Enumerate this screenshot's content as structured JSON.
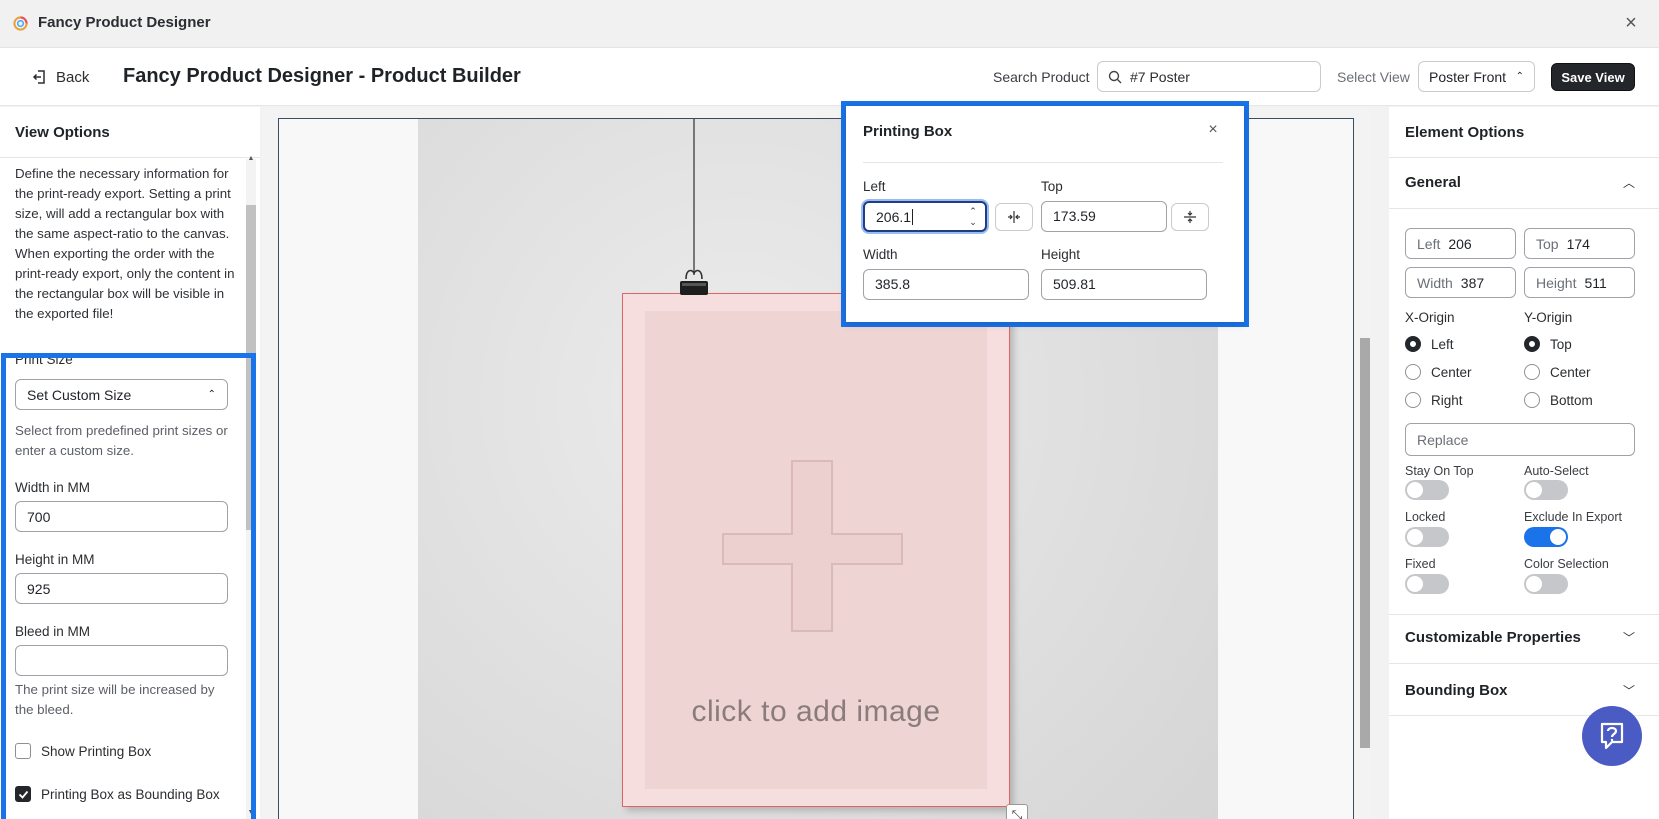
{
  "window": {
    "title": "Fancy Product Designer"
  },
  "header": {
    "back_label": "Back",
    "page_title": "Fancy Product Designer - Product Builder",
    "search_label": "Search Product",
    "search_value": "#7 Poster",
    "view_label": "Select View",
    "view_value": "Poster Front",
    "save_label": "Save View"
  },
  "left": {
    "heading": "View Options",
    "description": "Define the necessary information for the print-ready export. Setting a print size, will add a rectangular box with the same aspect-ratio to the canvas. When exporting the order with the print-ready export, only the content in the rectangular box will be visible in the exported file!",
    "print_size_label": "Print Size",
    "print_size_value": "Set Custom Size",
    "print_size_help": "Select from predefined print sizes or enter a custom size.",
    "width_label": "Width in MM",
    "width_value": "700",
    "height_label": "Height in MM",
    "height_value": "925",
    "bleed_label": "Bleed in MM",
    "bleed_value": "",
    "bleed_help": "The print size will be increased by the bleed.",
    "show_box_label": "Show Printing Box",
    "show_box_checked": false,
    "as_bounding_label": "Printing Box as Bounding Box",
    "as_bounding_checked": true
  },
  "canvas": {
    "placeholder_text": "click to add image"
  },
  "printing_box": {
    "title": "Printing Box",
    "left_label": "Left",
    "left_value": "206.1",
    "top_label": "Top",
    "top_value": "173.59",
    "width_label": "Width",
    "width_value": "385.8",
    "height_label": "Height",
    "height_value": "509.81"
  },
  "right": {
    "heading": "Element Options",
    "general_label": "General",
    "left_label": "Left",
    "left_value": "206",
    "top_label": "Top",
    "top_value": "174",
    "width_label": "Width",
    "width_value": "387",
    "height_label": "Height",
    "height_value": "511",
    "x_origin_label": "X-Origin",
    "x_origin_options": [
      "Left",
      "Center",
      "Right"
    ],
    "x_origin_selected": "Left",
    "y_origin_label": "Y-Origin",
    "y_origin_options": [
      "Top",
      "Center",
      "Bottom"
    ],
    "y_origin_selected": "Top",
    "replace_placeholder": "Replace",
    "stay_on_top_label": "Stay On Top",
    "auto_select_label": "Auto-Select",
    "locked_label": "Locked",
    "exclude_export_label": "Exclude In Export",
    "fixed_label": "Fixed",
    "color_selection_label": "Color Selection",
    "customizable_label": "Customizable Properties",
    "bounding_box_label": "Bounding Box"
  },
  "colors": {
    "accent": "#1a73e8",
    "dark_button": "#23262b",
    "help_bubble": "#4b5bc4"
  },
  "icons": [
    "app-logo-icon",
    "close-icon",
    "back-icon",
    "search-icon",
    "updown-chevron-icon",
    "center-horizontal-icon",
    "center-vertical-icon",
    "chevron-up-icon",
    "chevron-down-icon",
    "resize-icon",
    "help-chat-icon"
  ]
}
